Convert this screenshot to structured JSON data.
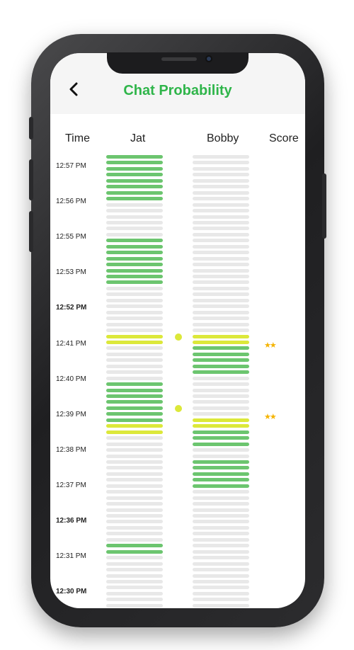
{
  "header": {
    "title": "Chat Probability"
  },
  "columns": {
    "time": "Time",
    "jat": "Jat",
    "bobby": "Bobby",
    "score": "Score"
  },
  "colors": {
    "accent": "#2fb54a",
    "match_green": "#6cc56f",
    "partial_yellow": "#dce83a",
    "empty_gray": "#e8e8e8",
    "star": "#f5b400"
  },
  "rows": 76,
  "time_labels": [
    {
      "label": "12:57 PM",
      "bold": false
    },
    {
      "label": "12:56 PM",
      "bold": false
    },
    {
      "label": "12:55 PM",
      "bold": false
    },
    {
      "label": "12:53 PM",
      "bold": false
    },
    {
      "label": "12:52 PM",
      "bold": true
    },
    {
      "label": "12:41 PM",
      "bold": false
    },
    {
      "label": "12:40 PM",
      "bold": false
    },
    {
      "label": "12:39 PM",
      "bold": false
    },
    {
      "label": "12:38 PM",
      "bold": false
    },
    {
      "label": "12:37 PM",
      "bold": false
    },
    {
      "label": "12:36 PM",
      "bold": true
    },
    {
      "label": "12:31 PM",
      "bold": false
    },
    {
      "label": "12:30 PM",
      "bold": true
    }
  ],
  "jat": {
    "green_rows": [
      0,
      1,
      2,
      3,
      4,
      5,
      6,
      7,
      14,
      15,
      16,
      17,
      18,
      19,
      20,
      21,
      38,
      39,
      40,
      41,
      42,
      43,
      44,
      45,
      65,
      66
    ],
    "yellow_rows": [
      30,
      31,
      45,
      46
    ]
  },
  "bobby": {
    "green_rows": [
      32,
      33,
      34,
      35,
      36,
      46,
      47,
      48,
      51,
      52,
      53,
      54,
      55
    ],
    "yellow_rows": [
      30,
      31,
      44,
      45
    ]
  },
  "matches": [
    {
      "dot_row": 30,
      "score_icon": "star-icon",
      "score": "★★"
    },
    {
      "dot_row": 42,
      "score_icon": "star-icon",
      "score": "★★"
    }
  ]
}
